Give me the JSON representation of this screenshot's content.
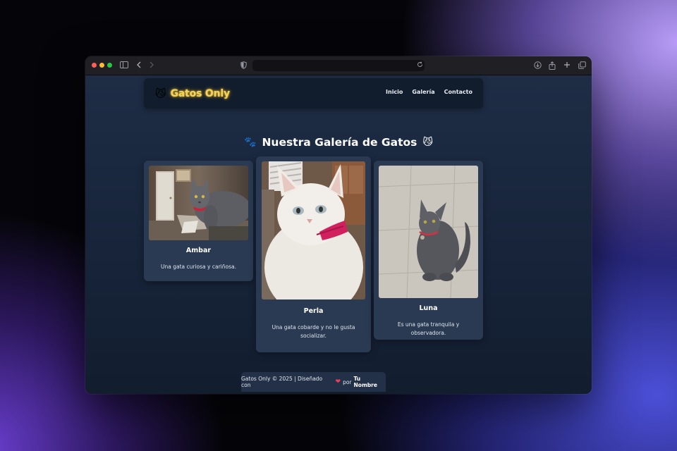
{
  "browser": {
    "address": ""
  },
  "site": {
    "brand_icon": "😼",
    "brand": "Gatos Only",
    "nav": [
      "Inicio",
      "Galería",
      "Contacto"
    ],
    "gallery_title": "Nuestra Galería de Gatos",
    "gallery_icon_left": "🐾",
    "gallery_icon_right": "😼"
  },
  "cats": [
    {
      "name": "Ambar",
      "description": "Una gata curiosa y cariñosa.",
      "photo": "gray cat with red collar indoors"
    },
    {
      "name": "Perla",
      "description": "Una gata cobarde y no le gusta socializar.",
      "photo": "white cat selfie with pink collar"
    },
    {
      "name": "Luna",
      "description": "Es una gata tranquila y observadora.",
      "photo": "gray cat sitting on tile floor"
    }
  ],
  "footer": {
    "text_before": "Gatos Only © 2025 | Diseñado con",
    "heart": "❤",
    "text_mid": "por",
    "author": "Tu Nombre"
  }
}
